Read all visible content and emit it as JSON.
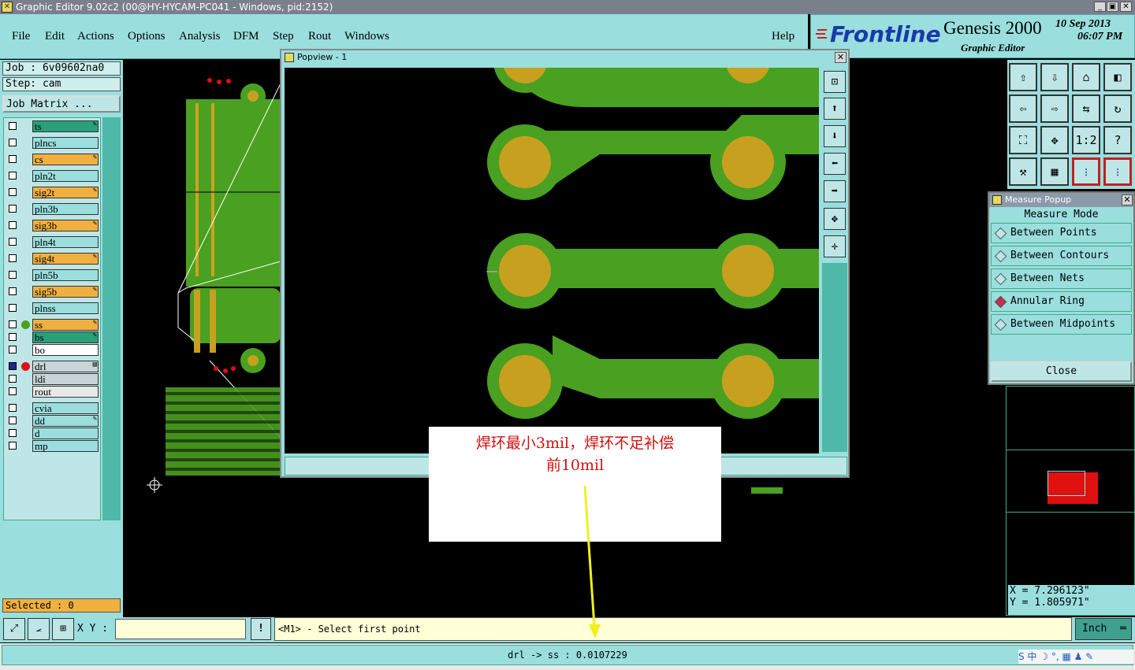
{
  "window": {
    "title": "Graphic Editor 9.02c2 (00@HY-HYCAM-PC041 - Windows, pid:2152)",
    "minimize": "_",
    "restore": "▣",
    "close": "✕"
  },
  "menu": {
    "file": "File",
    "edit": "Edit",
    "actions": "Actions",
    "options": "Options",
    "analysis": "Analysis",
    "dfm": "DFM",
    "step": "Step",
    "rout": "Rout",
    "windows": "Windows",
    "help": "Help"
  },
  "brand": {
    "logo": "Frontline",
    "product": "Genesis 2000",
    "subtitle": "Graphic Editor",
    "date": "10 Sep 2013",
    "time": "06:07 PM"
  },
  "job": {
    "job_label": "Job : 6v09602na0",
    "step_label": "Step: cam",
    "matrix_button": "Job Matrix ..."
  },
  "layers": [
    {
      "name": "ts",
      "color": "#2aa07a",
      "pen": "✎"
    },
    {
      "name": "plncs",
      "color": "#9adede",
      "pen": ""
    },
    {
      "name": "cs",
      "color": "#f0b040",
      "pen": "✎"
    },
    {
      "name": "pln2t",
      "color": "#9adede",
      "pen": ""
    },
    {
      "name": "sig2t",
      "color": "#f0b040",
      "pen": "✎"
    },
    {
      "name": "pln3b",
      "color": "#9adede",
      "pen": ""
    },
    {
      "name": "sig3b",
      "color": "#f0b040",
      "pen": "✎"
    },
    {
      "name": "pln4t",
      "color": "#9adede",
      "pen": ""
    },
    {
      "name": "sig4t",
      "color": "#f0b040",
      "pen": "✎"
    },
    {
      "name": "pln5b",
      "color": "#9adede",
      "pen": ""
    },
    {
      "name": "sig5b",
      "color": "#f0b040",
      "pen": "✎"
    },
    {
      "name": "plnss",
      "color": "#9adede",
      "pen": ""
    },
    {
      "name": "ss",
      "color": "#f0b040",
      "pen": "✎"
    },
    {
      "name": "bs",
      "color": "#2aa07a",
      "pen": "✎"
    },
    {
      "name": "bo",
      "color": "#ffffff",
      "pen": ""
    },
    {
      "name": "drl",
      "color": "#c8d4d8",
      "pen": "▤"
    },
    {
      "name": "ldi",
      "color": "#c8d4d8",
      "pen": ""
    },
    {
      "name": "rout",
      "color": "#e8e8e8",
      "pen": ""
    },
    {
      "name": "cvia",
      "color": "#9adede",
      "pen": ""
    },
    {
      "name": "dd",
      "color": "#9adede",
      "pen": "✎"
    },
    {
      "name": "d",
      "color": "#9adede",
      "pen": ""
    },
    {
      "name": "mp",
      "color": "#9adede",
      "pen": ""
    }
  ],
  "selected": "Selected : 0",
  "popview": {
    "title": "Popview - 1",
    "close": "✕"
  },
  "measure": {
    "title": "Measure Popup",
    "close": "✕",
    "mode_label": "Measure Mode",
    "options": [
      "Between Points",
      "Between Contours",
      "Between Nets",
      "Annular Ring",
      "Between Midpoints"
    ],
    "selected_option": "Annular Ring",
    "close_button": "Close"
  },
  "toolbar_icons": [
    "zoom-home-icon",
    "zoom-in-icon",
    "home-icon",
    "split-view-icon",
    "pan-left-icon",
    "pan-right-icon",
    "flip-icon",
    "redraw-icon",
    "fit-icon",
    "center-icon",
    "one-to-one-icon",
    "help-icon",
    "snap-icon",
    "grid-icon",
    "drill-check-icon",
    "drill-check-2-icon"
  ],
  "toolbar_labels": {
    "one_to_one": "1:2",
    "help": "?"
  },
  "coords": {
    "x": "X = 7.296123\"",
    "y": "Y = 1.805971\""
  },
  "status": {
    "xy_label": "X Y :",
    "xy_value": "",
    "prompt": "<M1> - Select first point",
    "units": "Inch",
    "result": "drl -> ss : 0.0107229"
  },
  "note": {
    "line1": "焊环最小3mil，焊环不足补偿",
    "line2": "前10mil"
  },
  "tray": {
    "ime": "中",
    "icons": "S 中 ☽ °, ▦ ♟ ✎"
  }
}
